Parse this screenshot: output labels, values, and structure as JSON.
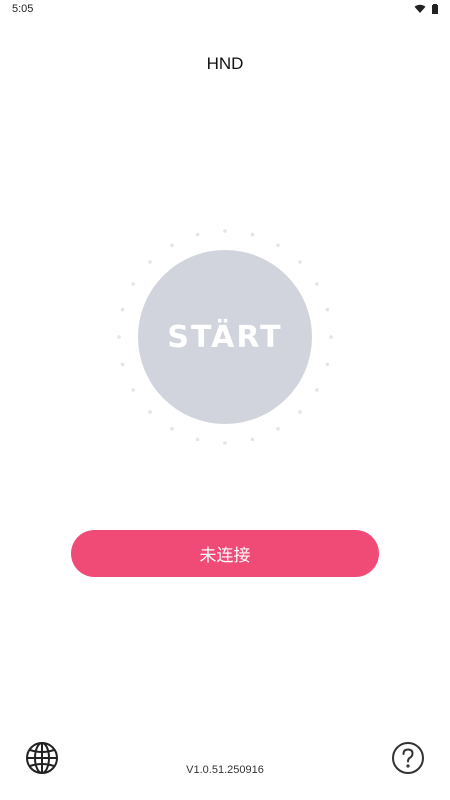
{
  "status_bar": {
    "time": "5:05",
    "icons": [
      "wifi-icon",
      "battery-icon"
    ]
  },
  "header": {
    "title": "HND"
  },
  "start_button": {
    "label": "STÄRT"
  },
  "connect_button": {
    "label": "未连接"
  },
  "footer": {
    "version": "V1.0.51.250916",
    "left_icon": "globe-icon",
    "right_icon": "help-icon"
  },
  "colors": {
    "accent": "#f04a77",
    "start_circle": "#d1d4dc",
    "dots": "#e3e5ea",
    "background": "#ffffff"
  }
}
